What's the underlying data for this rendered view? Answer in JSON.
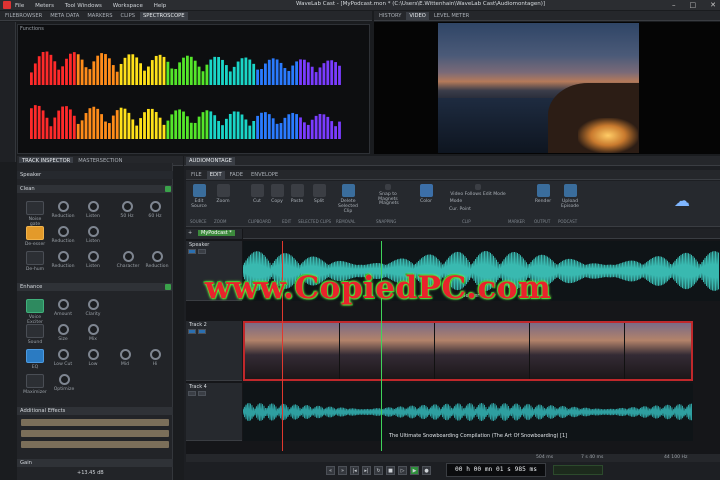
{
  "app": {
    "title": "WaveLab Cast - [MyPodcast.mon * (C:\\Users\\E.Wittenhain\\WaveLab Cast\\Audiomontagen)]",
    "menu": [
      "File",
      "Meters",
      "Tool Windows",
      "Workspace",
      "Help"
    ]
  },
  "top_tabs": [
    "FILEBROWSER",
    "META DATA",
    "MARKERS",
    "CLIPS",
    "SPECTROSCOPE"
  ],
  "spectro_label": "Functions",
  "spectro_colors": [
    "#ff2a2a",
    "#ff8c1a",
    "#ffe11a",
    "#54e62a",
    "#1ad6c8",
    "#2a7bff",
    "#7a3cff"
  ],
  "video_tabs": [
    "HISTORY",
    "VIDEO",
    "LEVEL METER"
  ],
  "inspector": {
    "tabs": [
      "TRACK INSPECTOR",
      "MASTERSECTION"
    ],
    "track_name": "Speaker",
    "sections": {
      "clean": "Clean",
      "enhance": "Enhance",
      "additional": "Additional Effects",
      "gain": "Gain"
    },
    "clean_controls": [
      "Noise gate",
      "Reduction",
      "Listen",
      "50 Hz",
      "60 Hz",
      "De-esser",
      "Reduction",
      "Listen",
      "De-hum",
      "Reduction",
      "Listen",
      "Character",
      "Reduction"
    ],
    "enhance_controls": [
      "Voice Exciter",
      "Amount",
      "Clarity",
      "Sound",
      "Size",
      "Mix",
      "EQ",
      "Low Cut",
      "Low",
      "Mid",
      "Hi",
      "Maximizer",
      "Optimize"
    ],
    "gain_value": "+13.45 dB"
  },
  "montage": {
    "title": "AUDIOMONTAGE",
    "tabs": [
      "FILE",
      "EDIT",
      "FADE",
      "ENVELOPE"
    ],
    "ribbon": [
      "Edit Source",
      "Zoom",
      "Cut",
      "Copy",
      "Paste",
      "Split",
      "Delete Selected Clip",
      "Snap to Magnets",
      "Magnets",
      "Color",
      "Video Follows Edit Mode",
      "Mode",
      "Cur. Point",
      "Render",
      "Upload Episode"
    ],
    "ribbon_groups": [
      "SOURCE",
      "ZOOM",
      "CLIPBOARD",
      "EDIT",
      "SELECTED CLIPS",
      "REMOVAL",
      "SNAPPING",
      "CLIP",
      "MARKER",
      "OUTPUT",
      "PODCAST"
    ],
    "doc_tab": "MyPodcast *",
    "tracks": [
      "Speaker",
      "Track 2",
      "Track 4"
    ],
    "clip_speaker": "Speaker",
    "clip_music": "The Ultimate Snowboarding Compilation (The Art Of Snowboarding) [1]"
  },
  "status": {
    "left": "504 ms",
    "mid": "7 s 40 ms",
    "right": "44 100 Hz"
  },
  "timecode": "00 h 00 mn 01 s 985 ms",
  "watermark": "www.CopiedPC.com"
}
